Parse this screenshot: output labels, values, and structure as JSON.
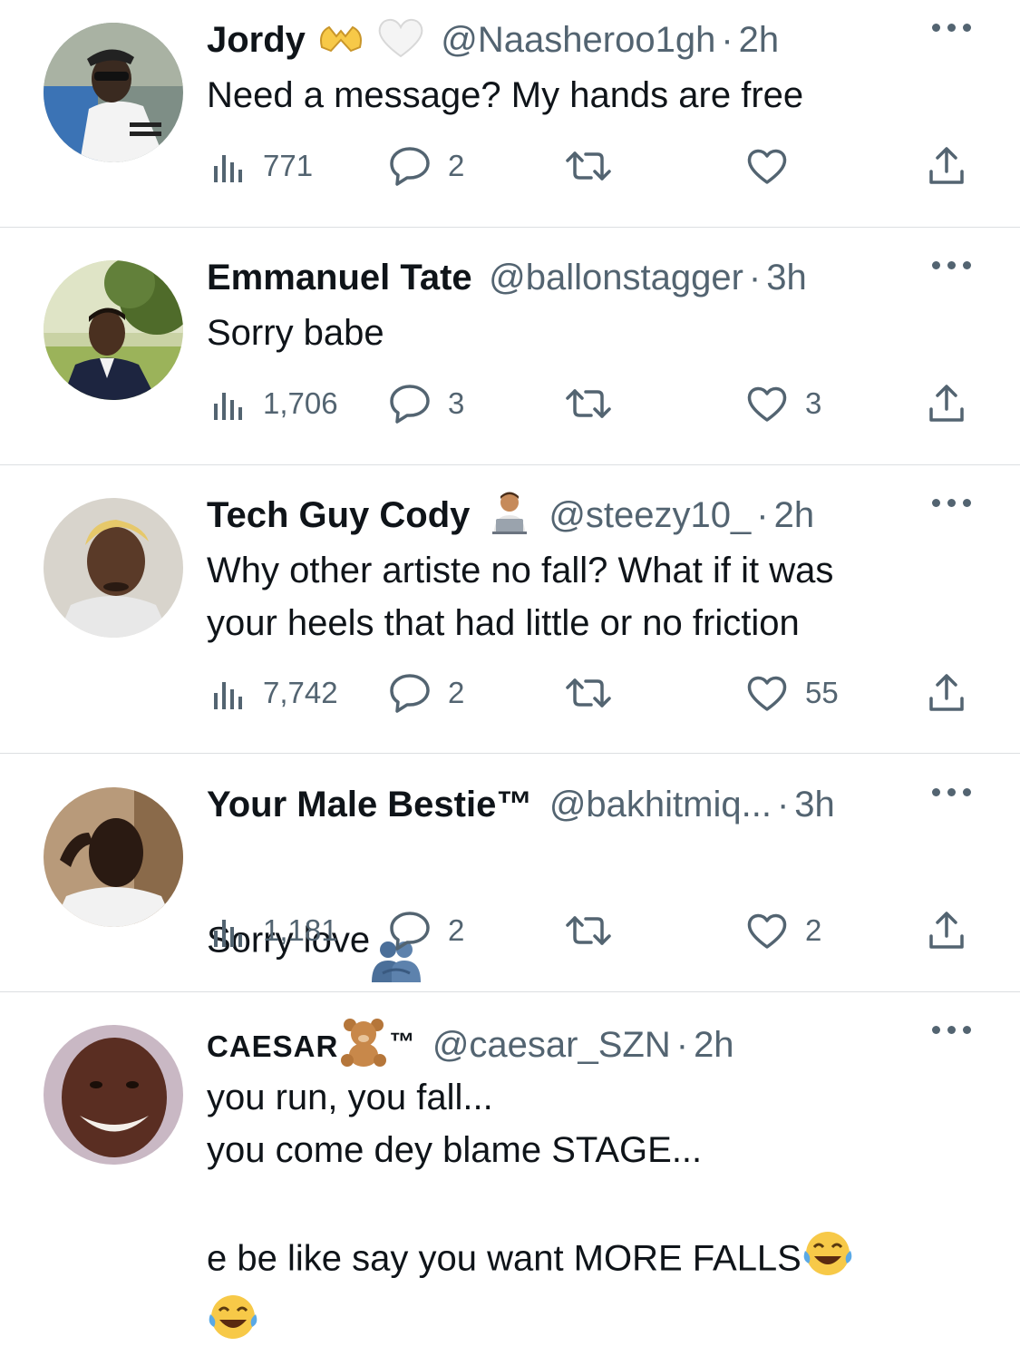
{
  "tweets": [
    {
      "name": "Jordy",
      "handle": "@Naasheroo1gh",
      "time": "2h",
      "name_emojis": [
        "hands-heart-icon",
        "white-heart-icon"
      ],
      "text": "Need a message? My hands are free",
      "views": "771",
      "replies": "2",
      "reposts": "",
      "likes": ""
    },
    {
      "name": "Emmanuel Tate",
      "handle": "@ballonstagger",
      "time": "3h",
      "text": "Sorry babe",
      "views": "1,706",
      "replies": "3",
      "reposts": "",
      "likes": "3"
    },
    {
      "name": "Tech Guy Cody",
      "handle": "@steezy10_",
      "time": "2h",
      "name_emojis": [
        "technologist-icon"
      ],
      "text": "Why other artiste no fall?  What if it was\nyour heels that had little or no friction",
      "views": "7,742",
      "replies": "2",
      "reposts": "",
      "likes": "55"
    },
    {
      "name": "Your Male Bestie™",
      "handle": "@bakhitmiq...",
      "time": "3h",
      "text": "Sorry love",
      "text_emoji": "people-hugging-icon",
      "views": "1,181",
      "replies": "2",
      "reposts": "",
      "likes": "2"
    },
    {
      "name": "CAESAR",
      "name_suffix": "™",
      "name_emojis": [
        "teddy-bear-icon"
      ],
      "handle": "@caesar_SZN",
      "time": "2h",
      "text_lines": [
        "you run, you fall...",
        "you come dey blame STAGE...",
        "",
        "e be like say you want MORE FALLS"
      ],
      "text_emoji": "tears-of-joy-icon"
    }
  ],
  "separator": "·",
  "colors": {
    "text": "#0f1419",
    "secondary": "#536471",
    "divider": "#dcdfe2"
  }
}
